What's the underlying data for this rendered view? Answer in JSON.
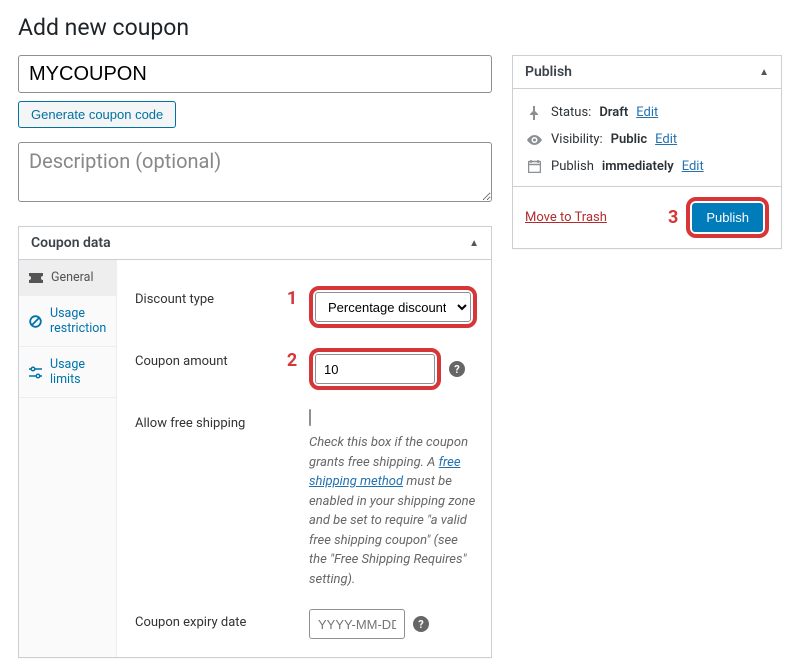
{
  "page_title": "Add new coupon",
  "coupon_code": "MYCOUPON",
  "generate_btn": "Generate coupon code",
  "desc_placeholder": "Description (optional)",
  "publish_box": {
    "title": "Publish",
    "status_label": "Status:",
    "status_value": "Draft",
    "visibility_label": "Visibility:",
    "visibility_value": "Public",
    "schedule_label": "Publish",
    "schedule_value": "immediately",
    "edit": "Edit",
    "trash": "Move to Trash",
    "publish_btn": "Publish"
  },
  "markers": {
    "m1": "1",
    "m2": "2",
    "m3": "3"
  },
  "coupon_box": {
    "title": "Coupon data",
    "tabs": {
      "general": "General",
      "restriction": "Usage restriction",
      "limits": "Usage limits"
    },
    "fields": {
      "discount_type_label": "Discount type",
      "discount_type_value": "Percentage discount",
      "amount_label": "Coupon amount",
      "amount_value": "10",
      "free_ship_label": "Allow free shipping",
      "free_ship_desc_a": "Check this box if the coupon grants free shipping. A ",
      "free_ship_link": "free shipping method",
      "free_ship_desc_b": " must be enabled in your shipping zone and be set to require \"a valid free shipping coupon\" (see the \"Free Shipping Requires\" setting).",
      "expiry_label": "Coupon expiry date",
      "expiry_placeholder": "YYYY-MM-DD"
    }
  }
}
